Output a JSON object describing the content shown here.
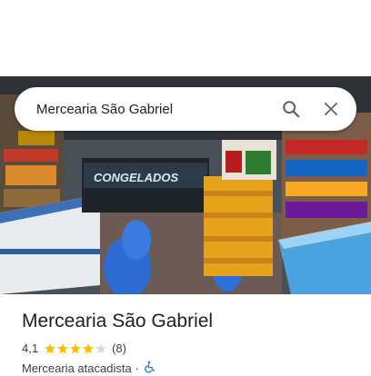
{
  "search": {
    "query": "Mercearia São Gabriel",
    "search_icon": "search-icon",
    "close_icon": "close-icon"
  },
  "photo": {
    "sign_text": "CONGELADOS",
    "description_icon": "store-photo"
  },
  "place": {
    "name": "Mercearia São Gabriel",
    "rating": "4,1",
    "rating_value": 4.1,
    "star_count": 5,
    "reviews": "(8)",
    "category": "Mercearia atacadista",
    "separator": "·",
    "accessibility_icon": "wheelchair-icon"
  },
  "colors": {
    "star": "#fbbc04",
    "star_empty": "#dadce0",
    "accessibility": "#1a73e8",
    "text_primary": "#202124",
    "text_secondary": "#3c4043"
  }
}
